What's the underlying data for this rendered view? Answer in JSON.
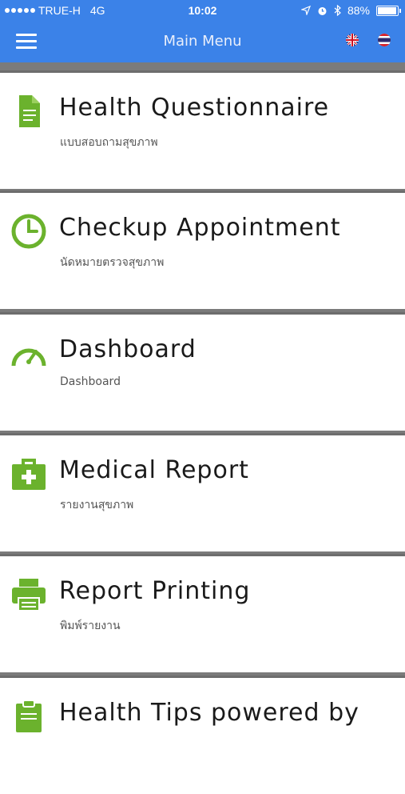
{
  "status_bar": {
    "carrier": "TRUE-H",
    "network": "4G",
    "time": "10:02",
    "battery": "88%",
    "battery_level": 0.88
  },
  "navbar": {
    "title": "Main Menu",
    "menu_icon": "hamburger-icon",
    "languages": [
      "english-flag-icon",
      "thai-flag-icon"
    ]
  },
  "colors": {
    "header": "#3b82e8",
    "accent": "#6bb22d",
    "separator": "#6d6d6d"
  },
  "menu": {
    "items": [
      {
        "title": "Health Questionnaire",
        "subtitle": "แบบสอบถามสุขภาพ",
        "icon": "document-icon"
      },
      {
        "title": "Checkup Appointment",
        "subtitle": "นัดหมายตรวจสุขภาพ",
        "icon": "clock-icon"
      },
      {
        "title": "Dashboard",
        "subtitle": "Dashboard",
        "icon": "speedometer-icon"
      },
      {
        "title": "Medical Report",
        "subtitle": "รายงานสุขภาพ",
        "icon": "medical-kit-icon"
      },
      {
        "title": "Report Printing",
        "subtitle": "พิมพ์รายงาน",
        "icon": "printer-icon"
      },
      {
        "title": "Health Tips powered by",
        "subtitle": "",
        "icon": "clipboard-icon"
      }
    ]
  }
}
